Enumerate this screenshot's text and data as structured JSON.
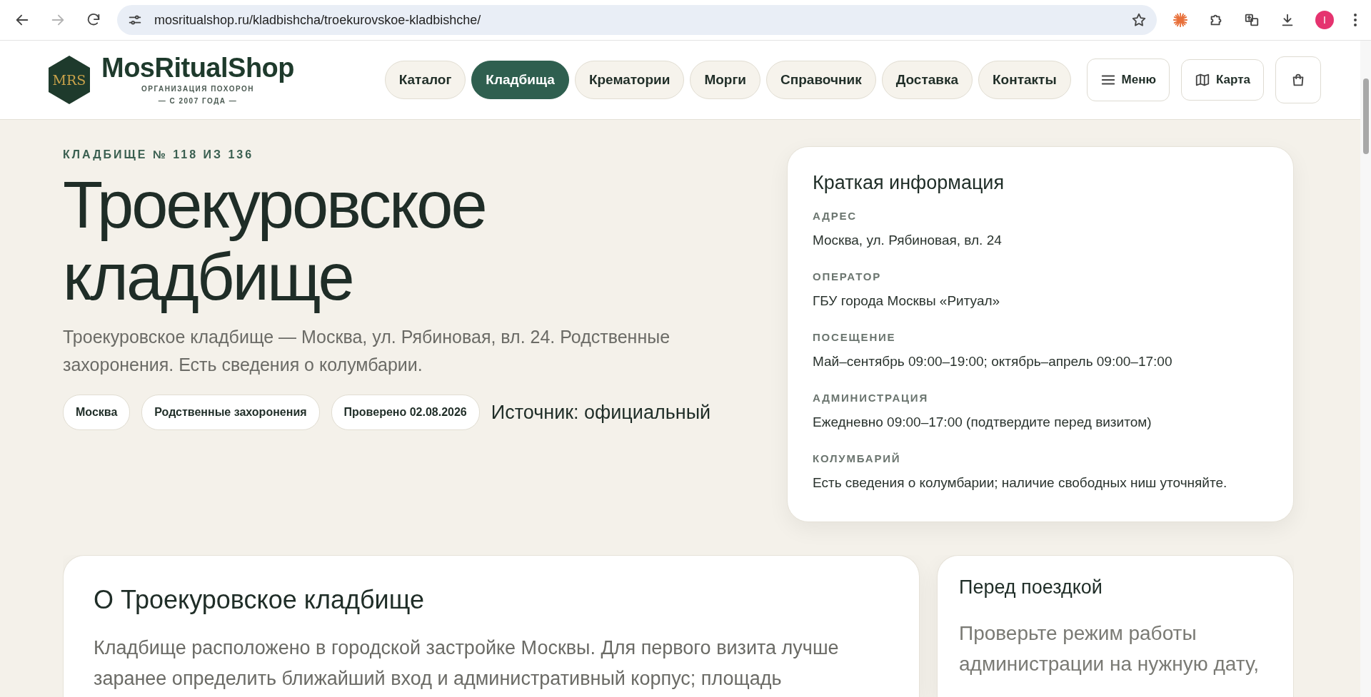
{
  "browser": {
    "url": "mosritualshop.ru/kladbishcha/troekurovskoe-kladbishche/",
    "forward_disabled": true,
    "profile_initial": "I"
  },
  "header": {
    "logo": {
      "monogram": "MRS",
      "name": "MosRitualShop",
      "tagline": "ОРГАНИЗАЦИЯ ПОХОРОН",
      "since": "— С 2007 ГОДА —"
    },
    "nav": [
      {
        "label": "Каталог",
        "selected": false
      },
      {
        "label": "Кладбища",
        "selected": true
      },
      {
        "label": "Крематории",
        "selected": false
      },
      {
        "label": "Морги",
        "selected": false
      },
      {
        "label": "Справочник",
        "selected": false
      },
      {
        "label": "Доставка",
        "selected": false
      },
      {
        "label": "Контакты",
        "selected": false
      }
    ],
    "menu_button": "Меню",
    "map_button": "Карта"
  },
  "hero": {
    "eyebrow": "КЛАДБИЩЕ № 118 ИЗ 136",
    "title": "Троекуровское кладбище",
    "lead": "Троекуровское кладбище — Москва, ул. Рябиновая, вл. 24. Родственные захоронения. Есть сведения о колумбарии.",
    "tags": [
      "Москва",
      "Родственные захоронения",
      "Проверено 02.08.2026"
    ],
    "source": "Источник: официальный"
  },
  "info_card": {
    "title": "Краткая информация",
    "fields": [
      {
        "label": "АДРЕС",
        "value": "Москва, ул. Рябиновая, вл. 24"
      },
      {
        "label": "ОПЕРАТОР",
        "value": "ГБУ города Москвы «Ритуал»"
      },
      {
        "label": "ПОСЕЩЕНИЕ",
        "value": "Май–сентябрь 09:00–19:00; октябрь–апрель 09:00–17:00"
      },
      {
        "label": "АДМИНИСТРАЦИЯ",
        "value": "Ежедневно 09:00–17:00 (подтвердите перед визитом)"
      },
      {
        "label": "КОЛУМБАРИЙ",
        "value": "Есть сведения о колумбарии; наличие свободных ниш уточняйте."
      }
    ]
  },
  "about": {
    "title": "О Троекуровское кладбище",
    "text": "Кладбище расположено в городской застройке Москвы. Для первого визита лучше заранее определить ближайший вход и административный корпус; площадь"
  },
  "before_trip": {
    "title": "Перед поездкой",
    "text": "Проверьте режим работы администрации на нужную дату,"
  }
}
